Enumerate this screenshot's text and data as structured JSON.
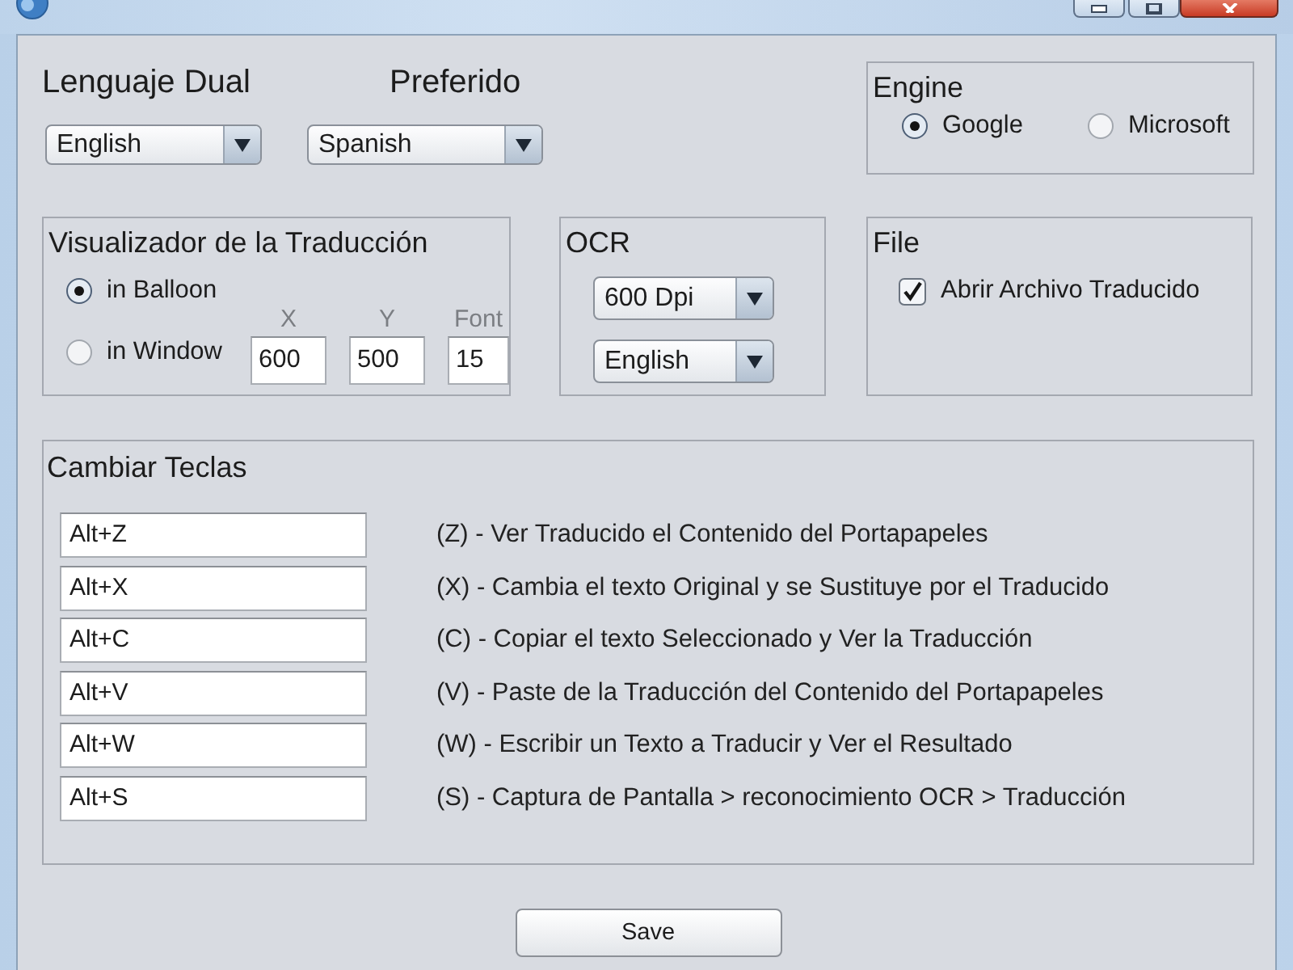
{
  "language": {
    "dual_label": "Lenguaje Dual",
    "dual_value": "English",
    "preferred_label": "Preferido",
    "preferred_value": "Spanish"
  },
  "engine": {
    "title": "Engine",
    "options": [
      {
        "label": "Google",
        "selected": true
      },
      {
        "label": "Microsoft",
        "selected": false
      }
    ]
  },
  "viewer": {
    "title": "Visualizador de la Traducción",
    "modes": [
      {
        "label": "in Balloon",
        "selected": true
      },
      {
        "label": "in Window",
        "selected": false
      }
    ],
    "fields": [
      {
        "label": "X",
        "value": "600"
      },
      {
        "label": "Y",
        "value": "500"
      },
      {
        "label": "Font",
        "value": "15"
      }
    ]
  },
  "ocr": {
    "title": "OCR",
    "resolution": "600 Dpi",
    "language": "English"
  },
  "file": {
    "title": "File",
    "options": [
      {
        "label": "Abrir Archivo Traducido",
        "checked": true
      }
    ]
  },
  "hotkeys": {
    "title": "Cambiar Teclas",
    "rows": [
      {
        "key": "Alt+Z",
        "description": "(Z) - Ver Traducido el Contenido del Portapapeles"
      },
      {
        "key": "Alt+X",
        "description": "(X) - Cambia el texto Original y se Sustituye por el Traducido"
      },
      {
        "key": "Alt+C",
        "description": "(C) - Copiar el texto Seleccionado y Ver la Traducción"
      },
      {
        "key": "Alt+V",
        "description": "(V) - Paste de la Traducción del Contenido del Portapapeles"
      },
      {
        "key": "Alt+W",
        "description": "(W) - Escribir un Texto a Traducir y Ver el Resultado"
      },
      {
        "key": "Alt+S",
        "description": "(S) - Captura de Pantalla > reconocimiento OCR > Traducción"
      }
    ]
  },
  "buttons": [
    {
      "label": "Save"
    }
  ]
}
